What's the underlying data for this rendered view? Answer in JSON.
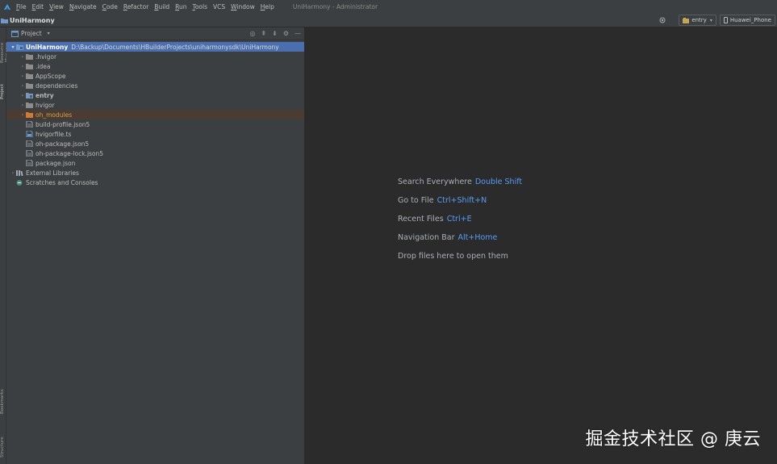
{
  "menubar": {
    "items": [
      {
        "mn": "F",
        "rest": "ile"
      },
      {
        "mn": "E",
        "rest": "dit"
      },
      {
        "mn": "V",
        "rest": "iew"
      },
      {
        "mn": "N",
        "rest": "avigate"
      },
      {
        "mn": "C",
        "rest": "ode"
      },
      {
        "mn": "R",
        "rest": "efactor"
      },
      {
        "mn": "B",
        "rest": "uild"
      },
      {
        "mn": "R",
        "rest": "un"
      },
      {
        "mn": "T",
        "rest": "ools"
      },
      {
        "mn": "",
        "rest": "VCS"
      },
      {
        "mn": "W",
        "rest": "indow"
      },
      {
        "mn": "H",
        "rest": "elp"
      }
    ],
    "window_title": "UniHarmony - Administrator"
  },
  "toolbar": {
    "project_name": "UniHarmony",
    "run_config": "entry",
    "device": "Huawei_Phone"
  },
  "side_tabs": {
    "project": "Project",
    "resource_manager": "Resource Manager",
    "bookmarks": "Bookmarks",
    "structure": "Structure"
  },
  "project_panel": {
    "title": "Project",
    "tree": [
      {
        "level": 0,
        "arrow": "down",
        "icon": "module",
        "label": "UniHarmony",
        "path": "D:\\Backup\\Documents\\HBuilderProjects\\uniharmonysdk\\UniHarmony",
        "bold": true,
        "selected": true
      },
      {
        "level": 1,
        "arrow": "right",
        "icon": "folder",
        "label": ".hvigor"
      },
      {
        "level": 1,
        "arrow": "right",
        "icon": "folder",
        "label": ".idea"
      },
      {
        "level": 1,
        "arrow": "right",
        "icon": "folder",
        "label": "AppScope"
      },
      {
        "level": 1,
        "arrow": "right",
        "icon": "folder",
        "label": "dependencies"
      },
      {
        "level": 1,
        "arrow": "right",
        "icon": "module-folder",
        "label": "entry",
        "bold": true
      },
      {
        "level": 1,
        "arrow": "right",
        "icon": "folder",
        "label": "hvigor"
      },
      {
        "level": 1,
        "arrow": "right",
        "icon": "folder-orange",
        "label": "oh_modules",
        "highlight": true,
        "color": "#d2a04a"
      },
      {
        "level": 1,
        "arrow": "",
        "icon": "file",
        "label": "build-profile.json5"
      },
      {
        "level": 1,
        "arrow": "",
        "icon": "file-ts",
        "label": "hvigorfile.ts"
      },
      {
        "level": 1,
        "arrow": "",
        "icon": "file",
        "label": "oh-package.json5"
      },
      {
        "level": 1,
        "arrow": "",
        "icon": "file",
        "label": "oh-package-lock.json5"
      },
      {
        "level": 1,
        "arrow": "",
        "icon": "file",
        "label": "package.json"
      },
      {
        "level": 0,
        "arrow": "right",
        "icon": "libraries",
        "label": "External Libraries"
      },
      {
        "level": 0,
        "arrow": "",
        "icon": "scratches",
        "label": "Scratches and Consoles"
      }
    ]
  },
  "editor": {
    "hints": [
      {
        "label": "Search Everywhere",
        "key": "Double Shift"
      },
      {
        "label": "Go to File",
        "key": "Ctrl+Shift+N"
      },
      {
        "label": "Recent Files",
        "key": "Ctrl+E"
      },
      {
        "label": "Navigation Bar",
        "key": "Alt+Home"
      },
      {
        "label": "Drop files here to open them",
        "key": ""
      }
    ]
  },
  "watermark": "掘金技术社区 @ 庚云",
  "colors": {
    "accent": "#589df6",
    "selection": "#4b6eaf",
    "panel_bg": "#3c3f41",
    "editor_bg": "#2b2b2b"
  }
}
